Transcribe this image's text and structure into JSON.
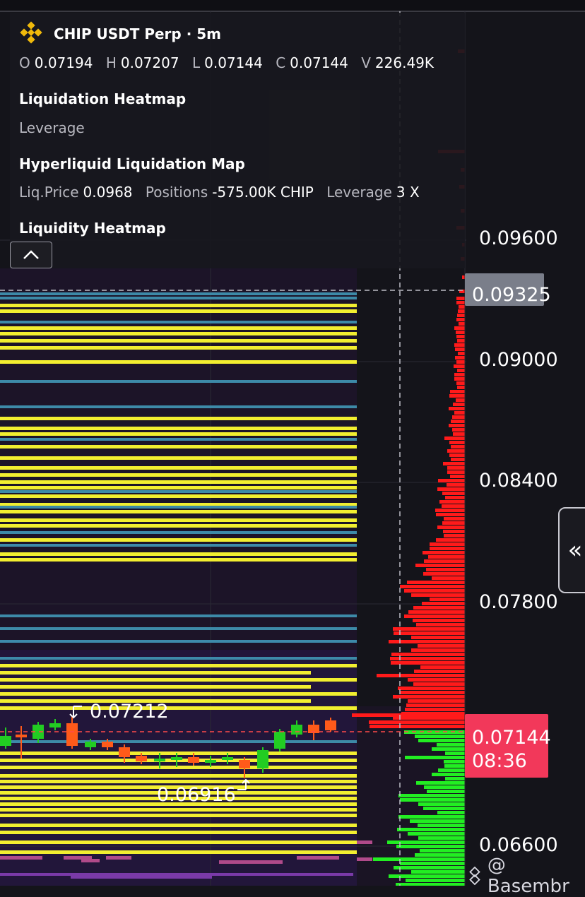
{
  "header": {
    "symbol_title": "CHIP USDT Perp · 5m",
    "ohlcv": [
      {
        "key": "O",
        "value": "0.07194"
      },
      {
        "key": "H",
        "value": "0.07207"
      },
      {
        "key": "L",
        "value": "0.07144"
      },
      {
        "key": "C",
        "value": "0.07144"
      },
      {
        "key": "V",
        "value": "226.49K"
      }
    ]
  },
  "indicators": {
    "liq_heatmap_title": "Liquidation Heatmap",
    "leverage_label": "Leverage",
    "hyperliquid_title": "Hyperliquid Liquidation Map",
    "liq_price_key": "Liq.Price",
    "liq_price_value": "0.0968",
    "positions_key": "Positions",
    "positions_value": "-575.00K CHIP",
    "leverage_key": "Leverage",
    "leverage_value": "3 X",
    "liquidity_title": "Liquidity Heatmap"
  },
  "price_axis": {
    "ticks": [
      "0.09600",
      "0.09000",
      "0.08400",
      "0.07800",
      "0.06600"
    ],
    "crosshair_price": "0.09325",
    "current_price": "0.07144",
    "countdown": "08:36"
  },
  "annotations": {
    "high_marker": "0.07212",
    "low_marker": "0.06916"
  },
  "watermark": "@ Basembr",
  "colors": {
    "background": "#14141a",
    "heat_yellow": "#f2ee30",
    "heat_teal": "#3d8aa8",
    "liq_red": "#ff1a1a",
    "liq_green": "#22ee22",
    "candle_up": "#22cc22",
    "candle_down": "#ff5a1a",
    "price_badge": "#f2385a",
    "crosshair_badge": "#7a7e8a"
  },
  "icons": {
    "logo": "binance-logo-icon",
    "collapse": "chevron-up-icon",
    "expand": "double-chevron-left-icon"
  }
}
